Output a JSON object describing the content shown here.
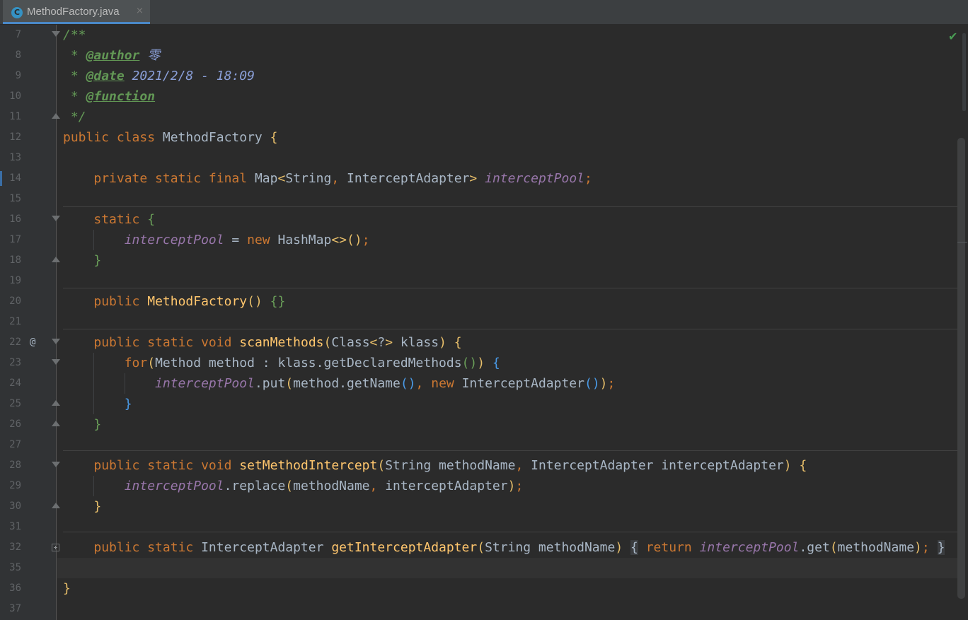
{
  "tab": {
    "icon_letter": "C",
    "filename": "MethodFactory.java",
    "close": "×"
  },
  "status": {
    "check": "✔"
  },
  "gutter": {
    "annotation": "@"
  },
  "lines": [
    {
      "n": "7",
      "text": "/**"
    },
    {
      "n": "8",
      "text": " * @author 零"
    },
    {
      "n": "9",
      "text": " * @date 2021/2/8 - 18:09"
    },
    {
      "n": "10",
      "text": " * @function"
    },
    {
      "n": "11",
      "text": " */"
    },
    {
      "n": "12",
      "text": "public class MethodFactory {"
    },
    {
      "n": "13",
      "text": ""
    },
    {
      "n": "14",
      "text": "    private static final Map<String, InterceptAdapter> interceptPool;"
    },
    {
      "n": "15",
      "text": ""
    },
    {
      "n": "16",
      "text": "    static {"
    },
    {
      "n": "17",
      "text": "        interceptPool = new HashMap<>();"
    },
    {
      "n": "18",
      "text": "    }"
    },
    {
      "n": "19",
      "text": ""
    },
    {
      "n": "20",
      "text": "    public MethodFactory() {}"
    },
    {
      "n": "21",
      "text": ""
    },
    {
      "n": "22",
      "text": "    public static void scanMethods(Class<?> klass) {"
    },
    {
      "n": "23",
      "text": "        for(Method method : klass.getDeclaredMethods()) {"
    },
    {
      "n": "24",
      "text": "            interceptPool.put(method.getName(), new InterceptAdapter());"
    },
    {
      "n": "25",
      "text": "        }"
    },
    {
      "n": "26",
      "text": "    }"
    },
    {
      "n": "27",
      "text": ""
    },
    {
      "n": "28",
      "text": "    public static void setMethodIntercept(String methodName, InterceptAdapter interceptAdapter) {"
    },
    {
      "n": "29",
      "text": "        interceptPool.replace(methodName, interceptAdapter);"
    },
    {
      "n": "30",
      "text": "    }"
    },
    {
      "n": "31",
      "text": ""
    },
    {
      "n": "32",
      "text": "    public static InterceptAdapter getInterceptAdapter(String methodName) { return interceptPool.get(methodName); }"
    },
    {
      "n": "35",
      "text": ""
    },
    {
      "n": "36",
      "text": "}"
    },
    {
      "n": "37",
      "text": ""
    }
  ],
  "colors": {
    "background": "#2b2b2b",
    "gutter": "#313335",
    "keyword": "#cc7832",
    "method": "#ffc66d",
    "field": "#9876aa",
    "comment": "#629755",
    "text": "#a9b7c6",
    "line_number": "#606366"
  }
}
